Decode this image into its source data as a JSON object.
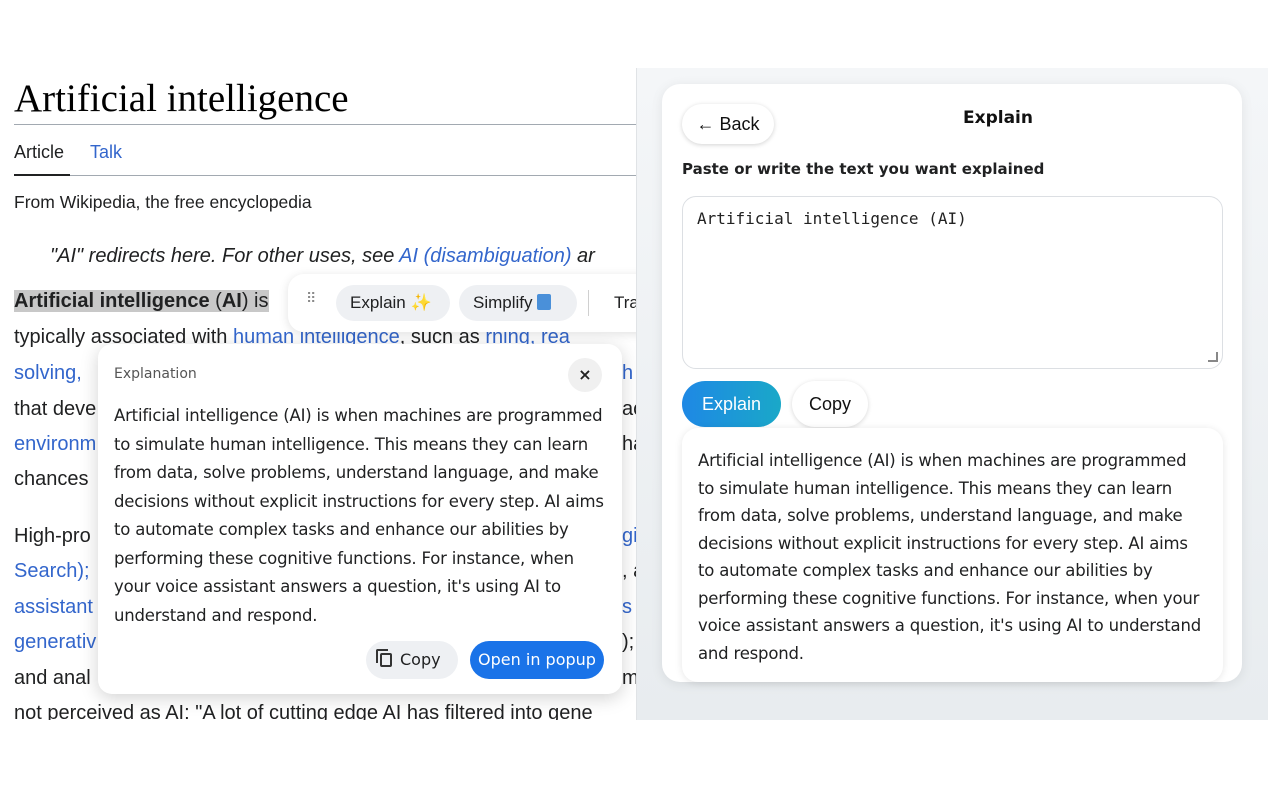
{
  "article": {
    "title": "Artificial intelligence",
    "tabs": [
      {
        "label": "Article"
      },
      {
        "label": "Talk"
      }
    ],
    "from_line": "From Wikipedia, the free encyclopedia",
    "hatnote_prefix": "\"AI\" redirects here. For other uses, see ",
    "hatnote_link": "AI (disambiguation)",
    "hatnote_suffix": " ar",
    "lines": [
      {
        "a": "Artificial intelligence",
        "b": " (",
        "c": "AI",
        "d": ") is"
      },
      {
        "a": "typically associated with ",
        "b": "human intelligence",
        "c": ", such as ",
        "d": "rning, rea"
      },
      {
        "a": "solving, ",
        "b": "h"
      },
      {
        "a": "that deve",
        "b": "ac"
      },
      {
        "a": "environm",
        "b": "ha"
      },
      {
        "a": "chances"
      },
      {
        "a": "High-pro",
        "b": "gi"
      },
      {
        "a": "Search);",
        "b": ", a"
      },
      {
        "a": "assistant",
        "b": "s v"
      },
      {
        "a": "generativ",
        "b": ");"
      },
      {
        "a": "and anal",
        "b": "m"
      },
      {
        "a": "not perceived as AI: \"A lot of cutting edge AI has filtered into gene"
      }
    ]
  },
  "toolbar": {
    "explain_label": "Explain",
    "explain_emoji": "✨",
    "simplify_label": "Simplify",
    "translate_label": "Tra"
  },
  "popup": {
    "label": "Explanation",
    "close": "×",
    "text": "Artificial intelligence (AI) is when machines are programmed to simulate human intelligence. This means they can learn from data, solve problems, understand language, and make decisions without explicit instructions for every step. AI aims to automate complex tasks and enhance our abilities by performing these cognitive functions. For instance, when your voice assistant answers a question, it's using AI to understand and respond.",
    "copy_label": "Copy",
    "open_label": "Open in popup"
  },
  "panel": {
    "back_label": "← Back",
    "title": "Explain",
    "field_label": "Paste or write the text you want explained",
    "input_value": "Artificial intelligence (AI)",
    "explain_button": "Explain",
    "copy_button": "Copy",
    "result": "Artificial intelligence (AI) is when machines are programmed to simulate human intelligence. This means they can learn from data, solve problems, understand language, and make decisions without explicit instructions for every step. AI aims to automate complex tasks and enhance our abilities by performing these cognitive functions. For instance, when your voice assistant answers a question, it's using AI to understand and respond."
  },
  "colors": {
    "link": "#3366cc",
    "primary": "#1a73e8",
    "explain_gradient_start": "#1e88e5",
    "explain_gradient_end": "#1aa8c8"
  }
}
